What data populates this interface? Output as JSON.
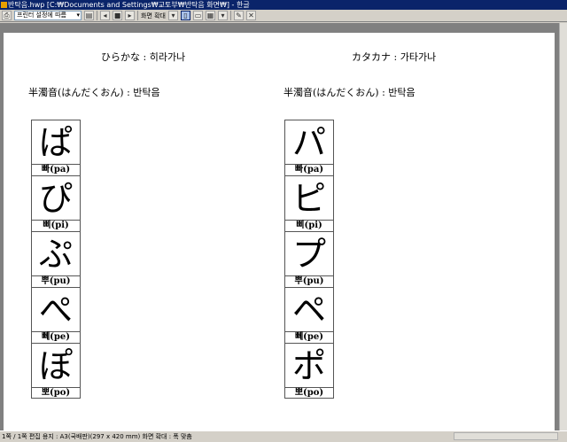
{
  "window": {
    "title": "반탁음.hwp [C:₩Documents and Settings₩교토부₩반탁음 화면₩] - 한글"
  },
  "toolbar": {
    "print_setting": "프린터 설정에 따름",
    "zoom_label": "화면 확대"
  },
  "page": {
    "hiragana_header": "ひらかな : 히라가나",
    "katakana_header": "カタカナ : 가타가나",
    "left_term": "半濁音(はんだくおん) : 반탁음",
    "right_term": "半濁音(はんだくおん) : 반탁음",
    "hiragana": [
      {
        "char": "ぱ",
        "reading": "빠(pa)"
      },
      {
        "char": "ぴ",
        "reading": "삐(pi)"
      },
      {
        "char": "ぷ",
        "reading": "뿌(pu)"
      },
      {
        "char": "ぺ",
        "reading": "뻬(pe)"
      },
      {
        "char": "ぽ",
        "reading": "뽀(po)"
      }
    ],
    "katakana": [
      {
        "char": "パ",
        "reading": "빠(pa)"
      },
      {
        "char": "ピ",
        "reading": "삐(pi)"
      },
      {
        "char": "プ",
        "reading": "뿌(pu)"
      },
      {
        "char": "ペ",
        "reading": "뻬(pe)"
      },
      {
        "char": "ポ",
        "reading": "뽀(po)"
      }
    ]
  },
  "status": {
    "text": "1쪽 / 1쪽  편집 용지 : A3(국배판)(297 x 420 mm)  화면 확대 : 폭 맞춤"
  }
}
